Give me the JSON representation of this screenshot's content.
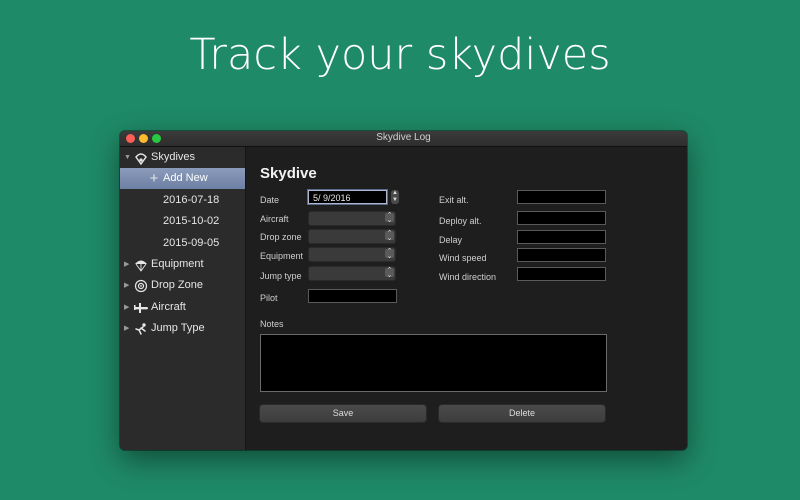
{
  "headline": "Track your skydives",
  "window": {
    "title": "Skydive Log"
  },
  "sidebar": {
    "skydives": "Skydives",
    "add_new": "Add New",
    "dates": [
      "2016-07-18",
      "2015-10-02",
      "2015-09-05"
    ],
    "equipment": "Equipment",
    "drop_zone": "Drop Zone",
    "aircraft": "Aircraft",
    "jump_type": "Jump Type"
  },
  "form": {
    "heading": "Skydive",
    "date_label": "Date",
    "date_value": "5/  9/2016",
    "aircraft_label": "Aircraft",
    "drop_zone_label": "Drop zone",
    "equipment_label": "Equipment",
    "jump_type_label": "Jump type",
    "pilot_label": "Pilot",
    "exit_alt_label": "Exit alt.",
    "deploy_alt_label": "Deploy alt.",
    "delay_label": "Delay",
    "wind_speed_label": "Wind speed",
    "wind_direction_label": "Wind direction",
    "notes_label": "Notes",
    "save_label": "Save",
    "delete_label": "Delete"
  },
  "colors": {
    "background": "#1f8a67",
    "selection": "#7a8bad",
    "window": "#1e1e1e"
  },
  "icons": {
    "skydives": "parachutist-icon",
    "equipment": "parachute-icon",
    "drop_zone": "target-icon",
    "aircraft": "airplane-icon",
    "jump_type": "jumper-icon"
  }
}
